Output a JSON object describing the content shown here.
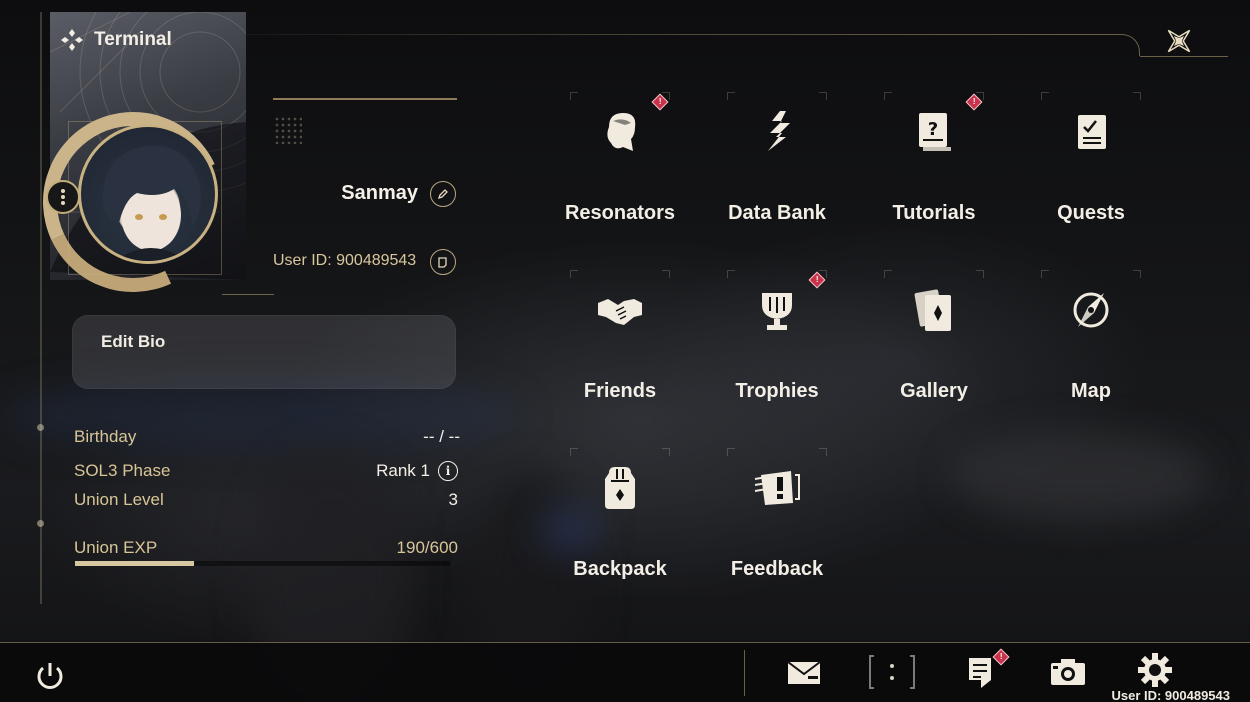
{
  "header": {
    "title": "Terminal"
  },
  "profile": {
    "name": "Sanmay",
    "user_id_text": "User ID: 900489543",
    "bio_label": "Edit Bio"
  },
  "stats": {
    "birthday_label": "Birthday",
    "birthday_value": "-- / --",
    "sol3_label": "SOL3 Phase",
    "sol3_value": "Rank 1",
    "union_level_label": "Union Level",
    "union_level_value": "3",
    "union_exp_label": "Union EXP",
    "union_exp_value": "190/600",
    "union_exp_current": 190,
    "union_exp_max": 600
  },
  "menu": {
    "items": [
      {
        "label": "Resonators",
        "icon": "resonator-icon",
        "badge": true
      },
      {
        "label": "Data Bank",
        "icon": "data-bank-icon",
        "badge": false
      },
      {
        "label": "Tutorials",
        "icon": "tutorials-icon",
        "badge": true
      },
      {
        "label": "Quests",
        "icon": "quests-icon",
        "badge": false
      },
      {
        "label": "Friends",
        "icon": "friends-icon",
        "badge": false
      },
      {
        "label": "Trophies",
        "icon": "trophies-icon",
        "badge": true
      },
      {
        "label": "Gallery",
        "icon": "gallery-icon",
        "badge": false
      },
      {
        "label": "Map",
        "icon": "map-icon",
        "badge": false
      },
      {
        "label": "Backpack",
        "icon": "backpack-icon",
        "badge": false
      },
      {
        "label": "Feedback",
        "icon": "feedback-icon",
        "badge": false
      }
    ]
  },
  "bottom_bar": {
    "buttons": [
      "power-icon",
      "mail-icon",
      "scan-icon",
      "notice-icon",
      "camera-icon",
      "settings-icon"
    ],
    "notice_badge": true,
    "user_id_text": "User ID: 900489543"
  },
  "colors": {
    "accent_gold": "#cbb489",
    "badge_red": "#c8324a",
    "label_gold": "#d7c597",
    "exp_fill": "#d8c8a2"
  }
}
